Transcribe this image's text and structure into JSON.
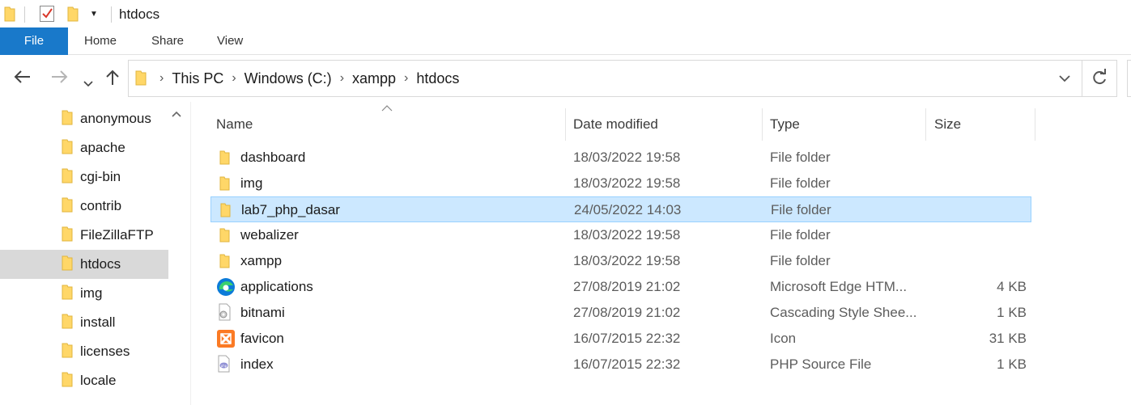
{
  "window": {
    "title": "htdocs"
  },
  "ribbon": {
    "tabs": [
      "File",
      "Home",
      "Share",
      "View"
    ]
  },
  "address": {
    "crumbs": [
      "This PC",
      "Windows (C:)",
      "xampp",
      "htdocs"
    ]
  },
  "navpane": {
    "items": [
      "anonymous",
      "apache",
      "cgi-bin",
      "contrib",
      "FileZillaFTP",
      "htdocs",
      "img",
      "install",
      "licenses",
      "locale"
    ],
    "selected": "htdocs"
  },
  "columns": {
    "name": "Name",
    "date": "Date modified",
    "type": "Type",
    "size": "Size"
  },
  "files": [
    {
      "name": "dashboard",
      "date": "18/03/2022 19:58",
      "type": "File folder",
      "size": "",
      "icon": "folder-icon"
    },
    {
      "name": "img",
      "date": "18/03/2022 19:58",
      "type": "File folder",
      "size": "",
      "icon": "folder-icon"
    },
    {
      "name": "lab7_php_dasar",
      "date": "24/05/2022 14:03",
      "type": "File folder",
      "size": "",
      "icon": "folder-icon"
    },
    {
      "name": "webalizer",
      "date": "18/03/2022 19:58",
      "type": "File folder",
      "size": "",
      "icon": "folder-icon"
    },
    {
      "name": "xampp",
      "date": "18/03/2022 19:58",
      "type": "File folder",
      "size": "",
      "icon": "folder-icon"
    },
    {
      "name": "applications",
      "date": "27/08/2019 21:02",
      "type": "Microsoft Edge HTM...",
      "size": "4 KB",
      "icon": "edge-html-icon"
    },
    {
      "name": "bitnami",
      "date": "27/08/2019 21:02",
      "type": "Cascading Style Shee...",
      "size": "1 KB",
      "icon": "css-file-icon"
    },
    {
      "name": "favicon",
      "date": "16/07/2015 22:32",
      "type": "Icon",
      "size": "31 KB",
      "icon": "xampp-icon"
    },
    {
      "name": "index",
      "date": "16/07/2015 22:32",
      "type": "PHP Source File",
      "size": "1 KB",
      "icon": "php-file-icon"
    }
  ],
  "selected_file": "lab7_php_dasar",
  "colors": {
    "accent": "#1979ca",
    "selection": "#cce8ff",
    "selection_border": "#99d1ff",
    "folder": "#ffd768"
  }
}
